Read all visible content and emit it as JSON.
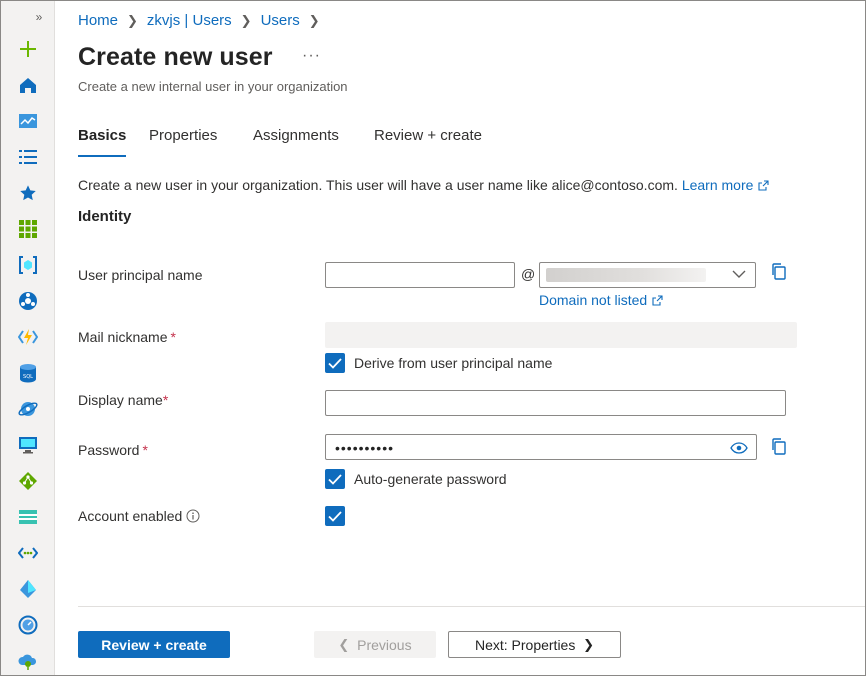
{
  "breadcrumb": [
    "Home",
    "zkvjs | Users",
    "Users"
  ],
  "page": {
    "title": "Create new user",
    "more": "···",
    "subtitle": "Create a new internal user in your organization"
  },
  "tabs": [
    "Basics",
    "Properties",
    "Assignments",
    "Review + create"
  ],
  "intro": {
    "text": "Create a new user in your organization. This user will have a user name like alice@contoso.com.",
    "learn_more": "Learn more"
  },
  "identity": {
    "heading": "Identity",
    "upn_label": "User principal name",
    "upn_value": "",
    "at_sign": "@",
    "domain_not_listed": "Domain not listed",
    "mail_nickname_label": "Mail nickname",
    "derive_label": "Derive from user principal name",
    "display_name_label": "Display name",
    "display_name_value": "",
    "password_label": "Password",
    "password_value": "••••••••••",
    "auto_generate_label": "Auto-generate password",
    "account_enabled_label": "Account enabled",
    "required_marker": "*"
  },
  "checkboxes": {
    "derive_from_upn": true,
    "auto_generate_password": true,
    "account_enabled": true
  },
  "footer": {
    "review_create": "Review + create",
    "previous": "Previous",
    "next": "Next: Properties"
  },
  "colors": {
    "accent": "#0f6cbd",
    "required": "#c4314b",
    "rail_background": "#f3f2f1"
  },
  "rail_icons": [
    "create-resource-icon",
    "home-icon",
    "dashboard-icon",
    "all-services-icon",
    "favorites-star-icon",
    "all-resources-icon",
    "resource-groups-icon",
    "app-services-icon",
    "function-app-icon",
    "sql-database-icon",
    "cosmos-db-icon",
    "virtual-machines-icon",
    "load-balancer-icon",
    "storage-accounts-icon",
    "virtual-networks-icon",
    "entra-id-icon",
    "monitor-icon",
    "advisor-icon"
  ]
}
